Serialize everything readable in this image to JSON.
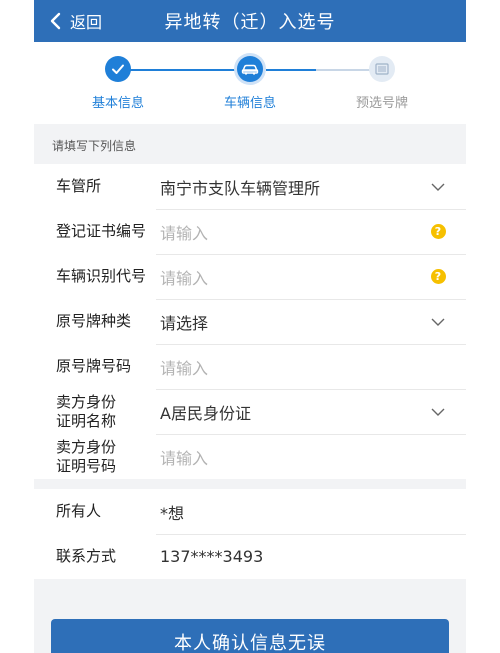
{
  "header": {
    "back_label": "返回",
    "title": "异地转（迁）入选号"
  },
  "steps": [
    {
      "label": "基本信息",
      "state": "done"
    },
    {
      "label": "车辆信息",
      "state": "current"
    },
    {
      "label": "预选号牌",
      "state": "pending"
    }
  ],
  "colors": {
    "primary": "#2e6fb8",
    "step_active": "#1f7fd8",
    "step_pending": "#c8d6e6",
    "help_icon": "#f6c000"
  },
  "form": {
    "hint": "请填写下列信息",
    "rows": [
      {
        "label": "车管所",
        "value": "南宁市支队车辆管理所",
        "type": "select"
      },
      {
        "label": "登记证书编号",
        "placeholder": "请输入",
        "type": "input-help"
      },
      {
        "label": "车辆识别代号",
        "placeholder": "请输入",
        "type": "input-help"
      },
      {
        "label": "原号牌种类",
        "value": "请选择",
        "type": "select"
      },
      {
        "label": "原号牌号码",
        "placeholder": "请输入",
        "type": "input"
      },
      {
        "label_line1": "卖方身份",
        "label_line2": "证明名称",
        "value": "A居民身份证",
        "type": "select"
      },
      {
        "label_line1": "卖方身份",
        "label_line2": "证明号码",
        "placeholder": "请输入",
        "type": "input"
      }
    ],
    "help_glyph": "?"
  },
  "owner": {
    "owner_label": "所有人",
    "owner_value": "*想",
    "contact_label": "联系方式",
    "contact_value": "137****3493"
  },
  "confirm_button": "本人确认信息无误"
}
